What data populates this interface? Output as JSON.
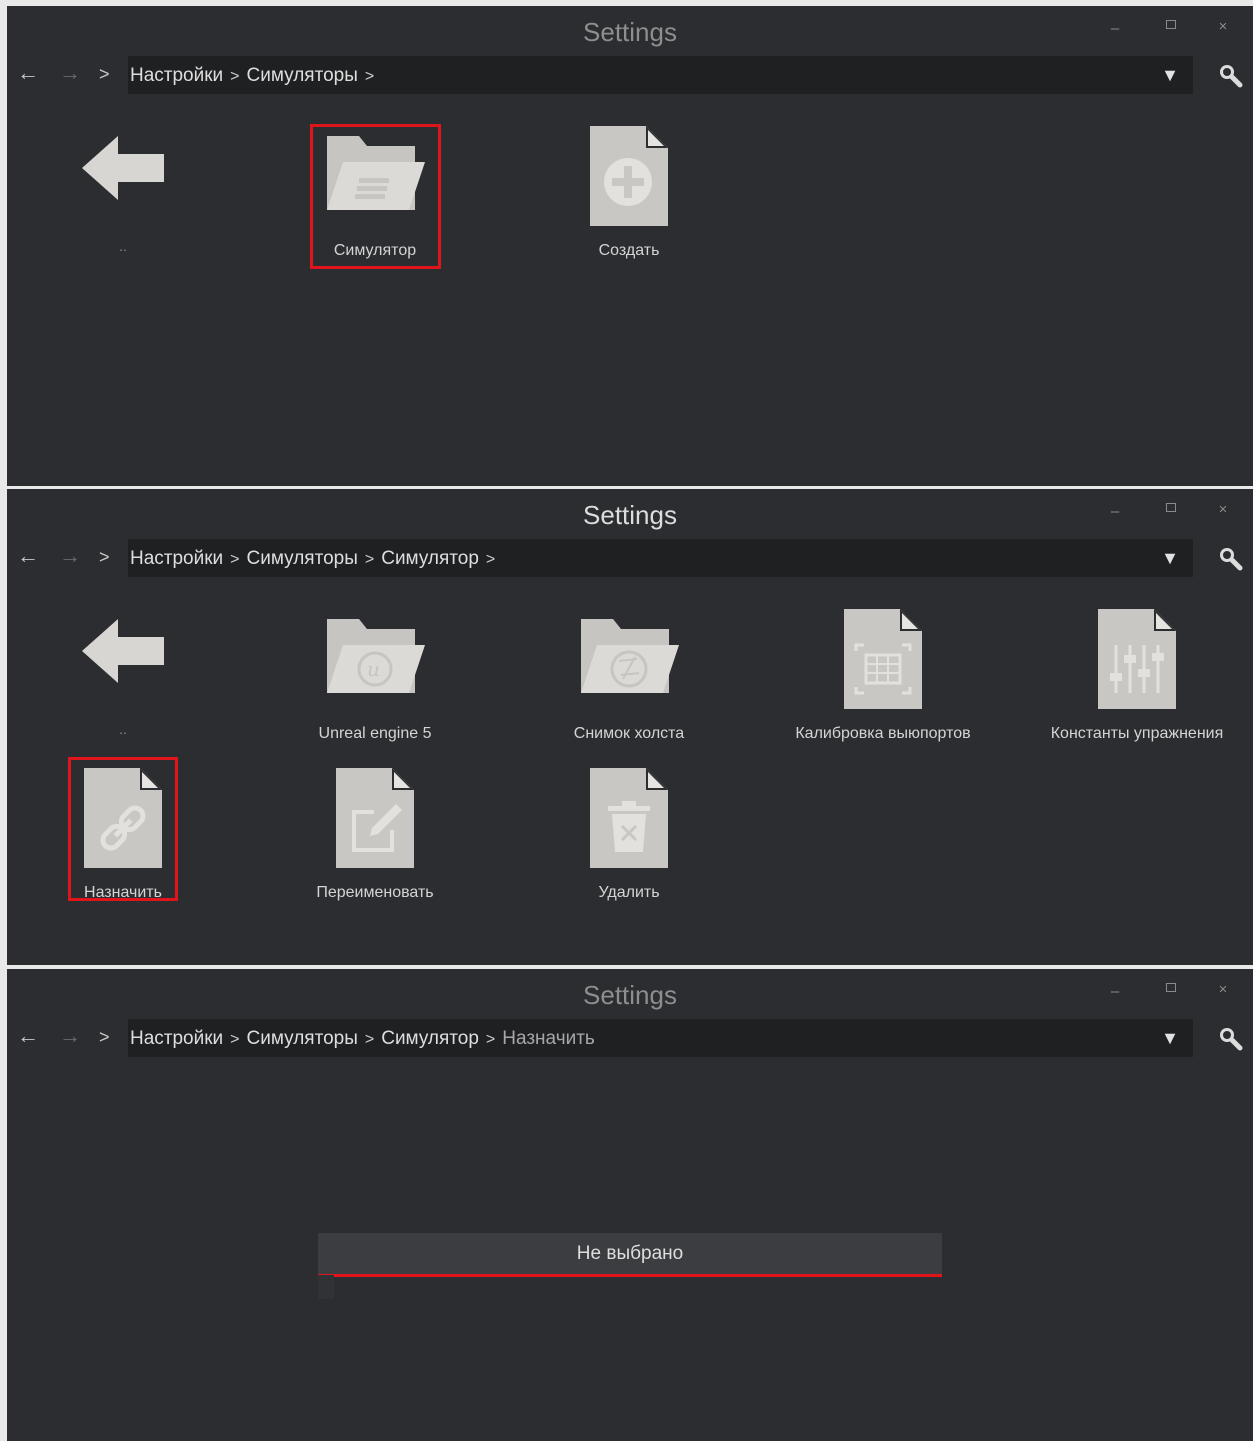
{
  "windows": [
    {
      "title": "Settings",
      "nav": {
        "back": "←",
        "forward": "→",
        "up": ">"
      },
      "breadcrumbs": [
        "Настройки",
        "Симуляторы"
      ],
      "trailing_separator": true,
      "tiles": [
        {
          "label": "..",
          "icon": "back-arrow-icon"
        },
        {
          "label": "Симулятор",
          "icon": "folder-icon",
          "highlighted": true
        },
        {
          "label": "Создать",
          "icon": "file-add-icon"
        }
      ]
    },
    {
      "title": "Settings",
      "nav": {
        "back": "←",
        "forward": "→",
        "up": ">"
      },
      "breadcrumbs": [
        "Настройки",
        "Симуляторы",
        "Симулятор"
      ],
      "trailing_separator": true,
      "tiles": [
        {
          "label": "..",
          "icon": "back-arrow-icon"
        },
        {
          "label": "Unreal engine 5",
          "icon": "folder-unreal-icon"
        },
        {
          "label": "Снимок холста",
          "icon": "folder-aperture-icon"
        },
        {
          "label": "Калибровка выюпортов",
          "icon": "file-calibration-icon"
        },
        {
          "label": "Константы упражнения",
          "icon": "file-sliders-icon"
        },
        {
          "label": "Назначить",
          "icon": "file-link-icon",
          "highlighted": true
        },
        {
          "label": "Переименовать",
          "icon": "file-edit-icon"
        },
        {
          "label": "Удалить",
          "icon": "file-delete-icon"
        }
      ]
    },
    {
      "title": "Settings",
      "nav": {
        "back": "←",
        "forward": "→",
        "up": ">"
      },
      "breadcrumbs": [
        "Настройки",
        "Симуляторы",
        "Симулятор"
      ],
      "current_crumb": "Назначить",
      "select": {
        "value": "Не выбрано"
      }
    }
  ],
  "window_controls": {
    "minimize": "–",
    "close": "×"
  },
  "accent_color": "#e0141b",
  "background_color": "#2b2d30"
}
